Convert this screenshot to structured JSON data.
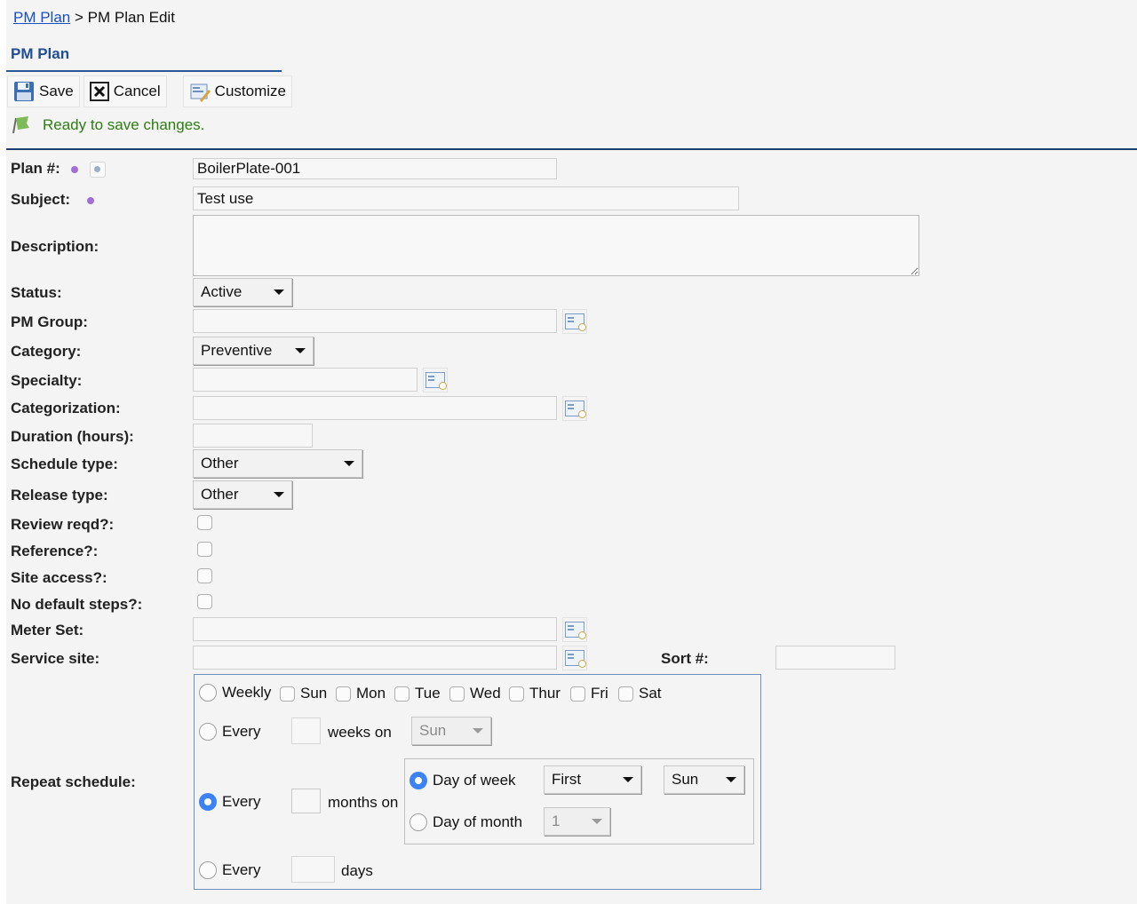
{
  "breadcrumb": {
    "link": "PM Plan",
    "separator": ">",
    "current": "PM Plan Edit"
  },
  "section_title": "PM Plan",
  "toolbar": {
    "save": "Save",
    "cancel": "Cancel",
    "customize": "Customize"
  },
  "status_message": "Ready to save changes.",
  "form": {
    "plan_no": {
      "label": "Plan #:",
      "value": "BoilerPlate-001"
    },
    "subject": {
      "label": "Subject:",
      "value": "Test use"
    },
    "description": {
      "label": "Description:",
      "value": ""
    },
    "status": {
      "label": "Status:",
      "value": "Active"
    },
    "pm_group": {
      "label": "PM Group:",
      "value": ""
    },
    "category": {
      "label": "Category:",
      "value": "Preventive"
    },
    "specialty": {
      "label": "Specialty:",
      "value": ""
    },
    "categorization": {
      "label": "Categorization:",
      "value": ""
    },
    "duration": {
      "label": "Duration (hours):",
      "value": ""
    },
    "schedule_type": {
      "label": "Schedule type:",
      "value": "Other"
    },
    "release_type": {
      "label": "Release type:",
      "value": "Other"
    },
    "review_reqd": {
      "label": "Review reqd?:",
      "checked": false
    },
    "reference": {
      "label": "Reference?:",
      "checked": false
    },
    "site_access": {
      "label": "Site access?:",
      "checked": false
    },
    "no_default_steps": {
      "label": "No default steps?:",
      "checked": false
    },
    "meter_set": {
      "label": "Meter Set:",
      "value": ""
    },
    "service_site": {
      "label": "Service site:",
      "value": ""
    },
    "sort_no": {
      "label": "Sort #:",
      "value": ""
    }
  },
  "repeat": {
    "label": "Repeat schedule:",
    "weekly": {
      "label": "Weekly",
      "days": [
        "Sun",
        "Mon",
        "Tue",
        "Wed",
        "Thur",
        "Fri",
        "Sat"
      ]
    },
    "every_weeks": {
      "every": "Every",
      "suffix": "weeks on",
      "select": "Sun"
    },
    "every_months": {
      "every": "Every",
      "suffix": "months on",
      "day_of_week": {
        "label": "Day of week",
        "ordinal": "First",
        "day": "Sun"
      },
      "day_of_month": {
        "label": "Day of month",
        "value": "1"
      }
    },
    "every_days": {
      "every": "Every",
      "suffix": "days"
    },
    "selected": "every_months"
  }
}
